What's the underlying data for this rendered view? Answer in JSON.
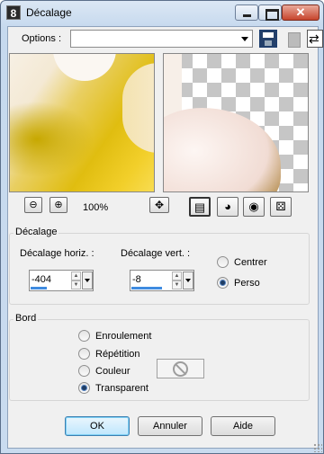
{
  "window": {
    "title": "Décalage",
    "app_icon_text": "8"
  },
  "options": {
    "label": "Options :",
    "value": ""
  },
  "zoom": {
    "level": "100%"
  },
  "decalage": {
    "group_label": "Décalage",
    "horiz_label": "Décalage horiz. :",
    "horiz_value": "-404",
    "vert_label": "Décalage vert. :",
    "vert_value": "-8",
    "centrer_label": "Centrer",
    "perso_label": "Perso",
    "selected": "Perso"
  },
  "bord": {
    "group_label": "Bord",
    "options": [
      "Enroulement",
      "Répétition",
      "Couleur",
      "Transparent"
    ],
    "selected": "Transparent"
  },
  "buttons": {
    "ok": "OK",
    "cancel": "Annuler",
    "help": "Aide"
  }
}
